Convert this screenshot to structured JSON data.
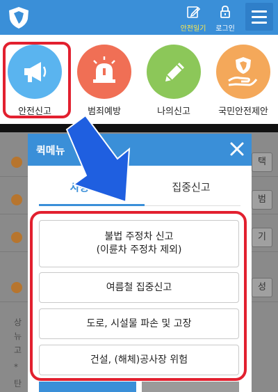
{
  "header": {
    "safety_diary_label": "안전일기",
    "login_label": "로그인"
  },
  "categories": [
    {
      "label": "안전신고",
      "icon": "megaphone-icon",
      "color": "#5ab4ef"
    },
    {
      "label": "범죄예방",
      "icon": "siren-icon",
      "color": "#f06f55"
    },
    {
      "label": "나의신고",
      "icon": "pencil-icon",
      "color": "#8cc759"
    },
    {
      "label": "국민안전제안",
      "icon": "hand-shield-icon",
      "color": "#f4a85a"
    }
  ],
  "background": {
    "row_tails": [
      "택",
      "범",
      "기",
      "성"
    ],
    "text_lines": [
      "상",
      "뉴",
      "고",
      "*",
      "탄"
    ]
  },
  "modal": {
    "title": "퀵메뉴",
    "tabs": [
      "사용자 메",
      "집중신고"
    ],
    "options": [
      {
        "line1": "불법 주정차 신고",
        "line2": "(이륜차 주정차 제외)"
      },
      {
        "line1": "여름철 집중신고"
      },
      {
        "line1": "도로, 시설물 파손 및 고장"
      },
      {
        "line1": "건설, (해체)공사장 위험"
      }
    ]
  },
  "colors": {
    "primary": "#3a8fd8",
    "highlight": "#e2202f",
    "arrow": "#1f5fe0"
  }
}
